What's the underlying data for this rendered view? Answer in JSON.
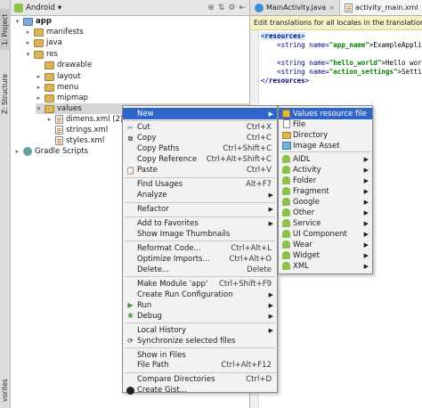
{
  "side_tabs": {
    "project": "1: Project",
    "structure": "Z: Structure",
    "favorites": "vorites"
  },
  "project_panel": {
    "view_mode": "Android",
    "tree": [
      {
        "label": "app",
        "indent": 0,
        "arrow": "▾",
        "icon": "folder-blue"
      },
      {
        "label": "manifests",
        "indent": 1,
        "arrow": "▸",
        "icon": "folder"
      },
      {
        "label": "java",
        "indent": 1,
        "arrow": "▸",
        "icon": "folder"
      },
      {
        "label": "res",
        "indent": 1,
        "arrow": "▾",
        "icon": "folder"
      },
      {
        "label": "drawable",
        "indent": 2,
        "arrow": "",
        "icon": "folder"
      },
      {
        "label": "layout",
        "indent": 2,
        "arrow": "▸",
        "icon": "folder"
      },
      {
        "label": "menu",
        "indent": 2,
        "arrow": "▸",
        "icon": "folder"
      },
      {
        "label": "mipmap",
        "indent": 2,
        "arrow": "▸",
        "icon": "folder"
      },
      {
        "label": "values",
        "indent": 2,
        "arrow": "▾",
        "icon": "folder",
        "selected": true
      },
      {
        "label": "dimens.xml (2)",
        "indent": 3,
        "arrow": "▸",
        "icon": "xml"
      },
      {
        "label": "strings.xml",
        "indent": 3,
        "arrow": "",
        "icon": "xml"
      },
      {
        "label": "styles.xml",
        "indent": 3,
        "arrow": "",
        "icon": "xml"
      },
      {
        "label": "Gradle Scripts",
        "indent": 0,
        "arrow": "▸",
        "icon": "gradle"
      }
    ]
  },
  "editor": {
    "tabs": [
      {
        "label": "MainActivity.java",
        "active": false
      },
      {
        "label": "activity_main.xml",
        "active": true
      }
    ],
    "info_bar": "Edit translations for all locales in the translations",
    "code_lines": [
      {
        "pre": "<",
        "tag": "resources",
        "post": ">",
        "val": "",
        "txt": ""
      },
      {
        "pre": "    <string name=",
        "tag": "",
        "post": "",
        "val": "\"app_name\"",
        "txt": ">ExampleAppli"
      },
      {
        "pre": "",
        "tag": "",
        "post": "",
        "val": "",
        "txt": ""
      },
      {
        "pre": "    <string name=",
        "tag": "",
        "post": "",
        "val": "\"hello_world\"",
        "txt": ">Hello worl"
      },
      {
        "pre": "    <string name=",
        "tag": "",
        "post": "",
        "val": "\"action_settings\"",
        "txt": ">Setti"
      },
      {
        "pre": "</",
        "tag": "resources",
        "post": ">",
        "val": "",
        "txt": ""
      }
    ]
  },
  "context_menu": {
    "items": [
      {
        "label": "New",
        "shortcut": "",
        "submenu": true,
        "icon": "",
        "selected": true
      },
      {
        "sep": true
      },
      {
        "label": "Cut",
        "shortcut": "Ctrl+X",
        "icon": "cut"
      },
      {
        "label": "Copy",
        "shortcut": "Ctrl+C",
        "icon": "copy"
      },
      {
        "label": "Copy Paths",
        "shortcut": "Ctrl+Shift+C",
        "icon": ""
      },
      {
        "label": "Copy Reference",
        "shortcut": "Ctrl+Alt+Shift+C",
        "icon": ""
      },
      {
        "label": "Paste",
        "shortcut": "Ctrl+V",
        "icon": "paste"
      },
      {
        "sep": true
      },
      {
        "label": "Find Usages",
        "shortcut": "Alt+F7",
        "icon": ""
      },
      {
        "label": "Analyze",
        "shortcut": "",
        "submenu": true,
        "icon": ""
      },
      {
        "sep": true
      },
      {
        "label": "Refactor",
        "shortcut": "",
        "submenu": true,
        "icon": ""
      },
      {
        "sep": true
      },
      {
        "label": "Add to Favorites",
        "shortcut": "",
        "submenu": true,
        "icon": ""
      },
      {
        "label": "Show Image Thumbnails",
        "shortcut": "",
        "icon": ""
      },
      {
        "sep": true
      },
      {
        "label": "Reformat Code...",
        "shortcut": "Ctrl+Alt+L",
        "icon": ""
      },
      {
        "label": "Optimize Imports...",
        "shortcut": "Ctrl+Alt+O",
        "icon": ""
      },
      {
        "label": "Delete...",
        "shortcut": "Delete",
        "icon": ""
      },
      {
        "sep": true
      },
      {
        "label": "Make Module 'app'",
        "shortcut": "Ctrl+Shift+F9",
        "icon": ""
      },
      {
        "label": "Create Run Configuration",
        "shortcut": "",
        "submenu": true,
        "icon": ""
      },
      {
        "label": "Run",
        "shortcut": "",
        "submenu": true,
        "icon": "run"
      },
      {
        "label": "Debug",
        "shortcut": "",
        "submenu": true,
        "icon": "debug"
      },
      {
        "sep": true
      },
      {
        "label": "Local History",
        "shortcut": "",
        "submenu": true,
        "icon": ""
      },
      {
        "label": "Synchronize selected files",
        "shortcut": "",
        "icon": "sync"
      },
      {
        "sep": true
      },
      {
        "label": "Show in Files",
        "shortcut": "",
        "icon": ""
      },
      {
        "label": "File Path",
        "shortcut": "Ctrl+Alt+F12",
        "icon": ""
      },
      {
        "sep": true
      },
      {
        "label": "Compare Directories",
        "shortcut": "Ctrl+D",
        "icon": ""
      },
      {
        "label": "Create Gist...",
        "shortcut": "",
        "icon": "github"
      }
    ]
  },
  "new_submenu": {
    "items": [
      {
        "label": "Values resource file",
        "submenu": false,
        "icon": "values",
        "selected": true
      },
      {
        "label": "File",
        "submenu": false,
        "icon": "file"
      },
      {
        "label": "Directory",
        "submenu": false,
        "icon": "dir"
      },
      {
        "label": "Image Asset",
        "submenu": false,
        "icon": "image"
      },
      {
        "sep": true
      },
      {
        "label": "AIDL",
        "submenu": true,
        "icon": "droid"
      },
      {
        "label": "Activity",
        "submenu": true,
        "icon": "droid"
      },
      {
        "label": "Folder",
        "submenu": true,
        "icon": "droid"
      },
      {
        "label": "Fragment",
        "submenu": true,
        "icon": "droid"
      },
      {
        "label": "Google",
        "submenu": true,
        "icon": "droid"
      },
      {
        "label": "Other",
        "submenu": true,
        "icon": "droid"
      },
      {
        "label": "Service",
        "submenu": true,
        "icon": "droid"
      },
      {
        "label": "UI Component",
        "submenu": true,
        "icon": "droid"
      },
      {
        "label": "Wear",
        "submenu": true,
        "icon": "droid"
      },
      {
        "label": "Widget",
        "submenu": true,
        "icon": "droid"
      },
      {
        "label": "XML",
        "submenu": true,
        "icon": "droid"
      }
    ]
  }
}
